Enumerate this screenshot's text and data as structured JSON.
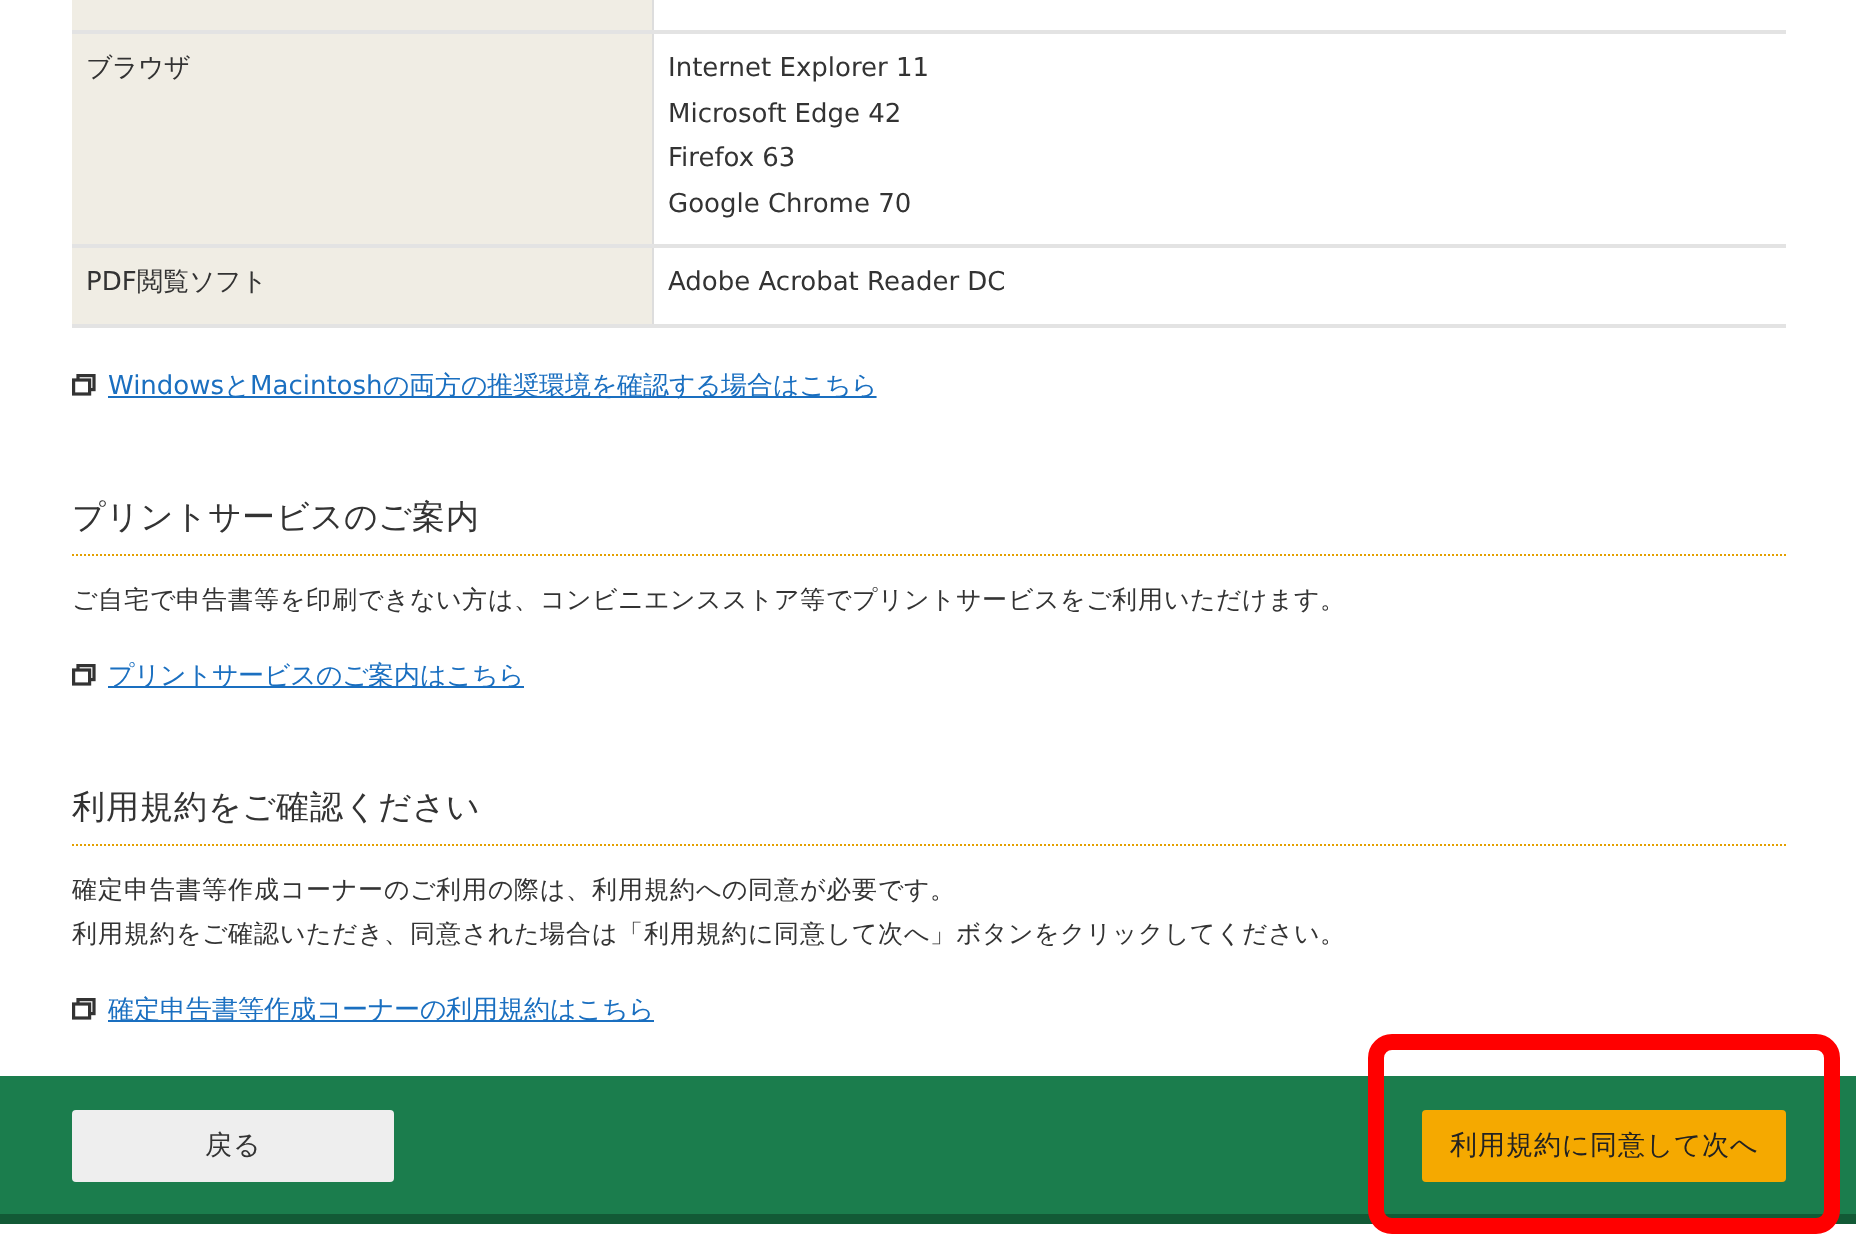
{
  "spec_table": {
    "rows": [
      {
        "label": "",
        "values": []
      },
      {
        "label": "ブラウザ",
        "values": [
          "Internet Explorer 11",
          "Microsoft Edge 42",
          "Firefox 63",
          "Google Chrome 70"
        ]
      },
      {
        "label": "PDF閲覧ソフト",
        "values": [
          "Adobe Acrobat Reader DC"
        ]
      }
    ]
  },
  "env_link": "WindowsとMacintoshの両方の推奨環境を確認する場合はこちら",
  "sections": [
    {
      "heading": "プリントサービスのご案内",
      "paragraphs": [
        "ご自宅で申告書等を印刷できない方は、コンビニエンスストア等でプリントサービスをご利用いただけます。"
      ],
      "link": "プリントサービスのご案内はこちら"
    },
    {
      "heading": "利用規約をご確認ください",
      "paragraphs": [
        "確定申告書等作成コーナーのご利用の際は、利用規約への同意が必要です。",
        "利用規約をご確認いただき、同意された場合は「利用規約に同意して次へ」ボタンをクリックしてください。"
      ],
      "link": "確定申告書等作成コーナーの利用規約はこちら"
    }
  ],
  "footer": {
    "back_button": "戻る",
    "next_button": "利用規約に同意して次へ",
    "next_highlighted": true
  }
}
